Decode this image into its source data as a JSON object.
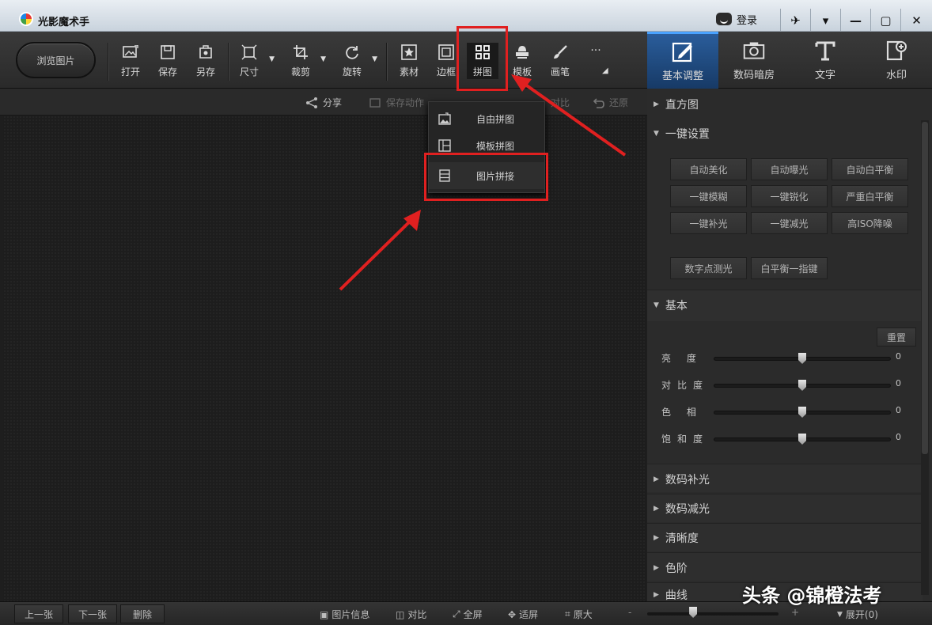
{
  "window": {
    "title": "光影魔术手",
    "login_label": "登录",
    "controls": [
      "✈",
      "▾",
      "—",
      "▢",
      "✕"
    ]
  },
  "toolbar": {
    "browse_label": "浏览图片",
    "tools": [
      {
        "name": "open",
        "label": "打开",
        "icon": "image-icon"
      },
      {
        "name": "save",
        "label": "保存",
        "icon": "save-icon"
      },
      {
        "name": "save-as",
        "label": "另存",
        "icon": "save-as-icon"
      },
      {
        "name": "size",
        "label": "尺寸",
        "icon": "resize-icon",
        "dropdown": true
      },
      {
        "name": "crop",
        "label": "裁剪",
        "icon": "crop-icon",
        "dropdown": true
      },
      {
        "name": "rotate",
        "label": "旋转",
        "icon": "rotate-icon",
        "dropdown": true
      },
      {
        "name": "material",
        "label": "素材",
        "icon": "star-icon"
      },
      {
        "name": "border",
        "label": "边框",
        "icon": "border-icon"
      },
      {
        "name": "collage",
        "label": "拼图",
        "icon": "grid-icon",
        "active": true
      },
      {
        "name": "template",
        "label": "模板",
        "icon": "stamp-icon"
      },
      {
        "name": "brush",
        "label": "画笔",
        "icon": "brush-icon"
      },
      {
        "name": "more",
        "label": "···",
        "icon": "more-icon"
      }
    ]
  },
  "right_tabs": [
    {
      "label": "基本调整",
      "icon": "edit-icon",
      "active": true
    },
    {
      "label": "数码暗房",
      "icon": "camera-icon"
    },
    {
      "label": "文字",
      "icon": "text-icon"
    },
    {
      "label": "水印",
      "icon": "watermark-icon"
    }
  ],
  "subbar": {
    "share": "分享",
    "save_action": "保存动作",
    "compare": "对比",
    "undo": "还原"
  },
  "collage_menu": [
    {
      "label": "自由拼图",
      "icon": "free-collage-icon"
    },
    {
      "label": "模板拼图",
      "icon": "template-collage-icon"
    },
    {
      "label": "图片拼接",
      "icon": "stitch-icon",
      "highlighted": true
    }
  ],
  "panel": {
    "histogram": "直方图",
    "one_click": {
      "title": "一键设置",
      "buttons": [
        "自动美化",
        "自动曝光",
        "自动白平衡",
        "一键模糊",
        "一键锐化",
        "严重白平衡",
        "一键补光",
        "一键减光",
        "高ISO降噪",
        "数字点测光",
        "白平衡一指键"
      ]
    },
    "basic": {
      "title": "基本",
      "reset": "重置",
      "sliders": [
        {
          "label": "亮  度",
          "value": "0",
          "level": 0.5
        },
        {
          "label": "对比度",
          "value": "0",
          "level": 0.5
        },
        {
          "label": "色  相",
          "value": "0",
          "level": 0.5
        },
        {
          "label": "饱和度",
          "value": "0",
          "level": 0.5
        }
      ]
    },
    "sections": [
      "数码补光",
      "数码减光",
      "清晰度",
      "色阶",
      "曲线"
    ]
  },
  "bottom": {
    "prev": "上一张",
    "next": "下一张",
    "delete": "删除",
    "info": "图片信息",
    "compare": "对比",
    "fullscreen": "全屏",
    "fit": "适屏",
    "original": "原大",
    "expand": "展开(0)",
    "zoom_level": 0.35
  },
  "watermark_text": "头条 @锦橙法考"
}
